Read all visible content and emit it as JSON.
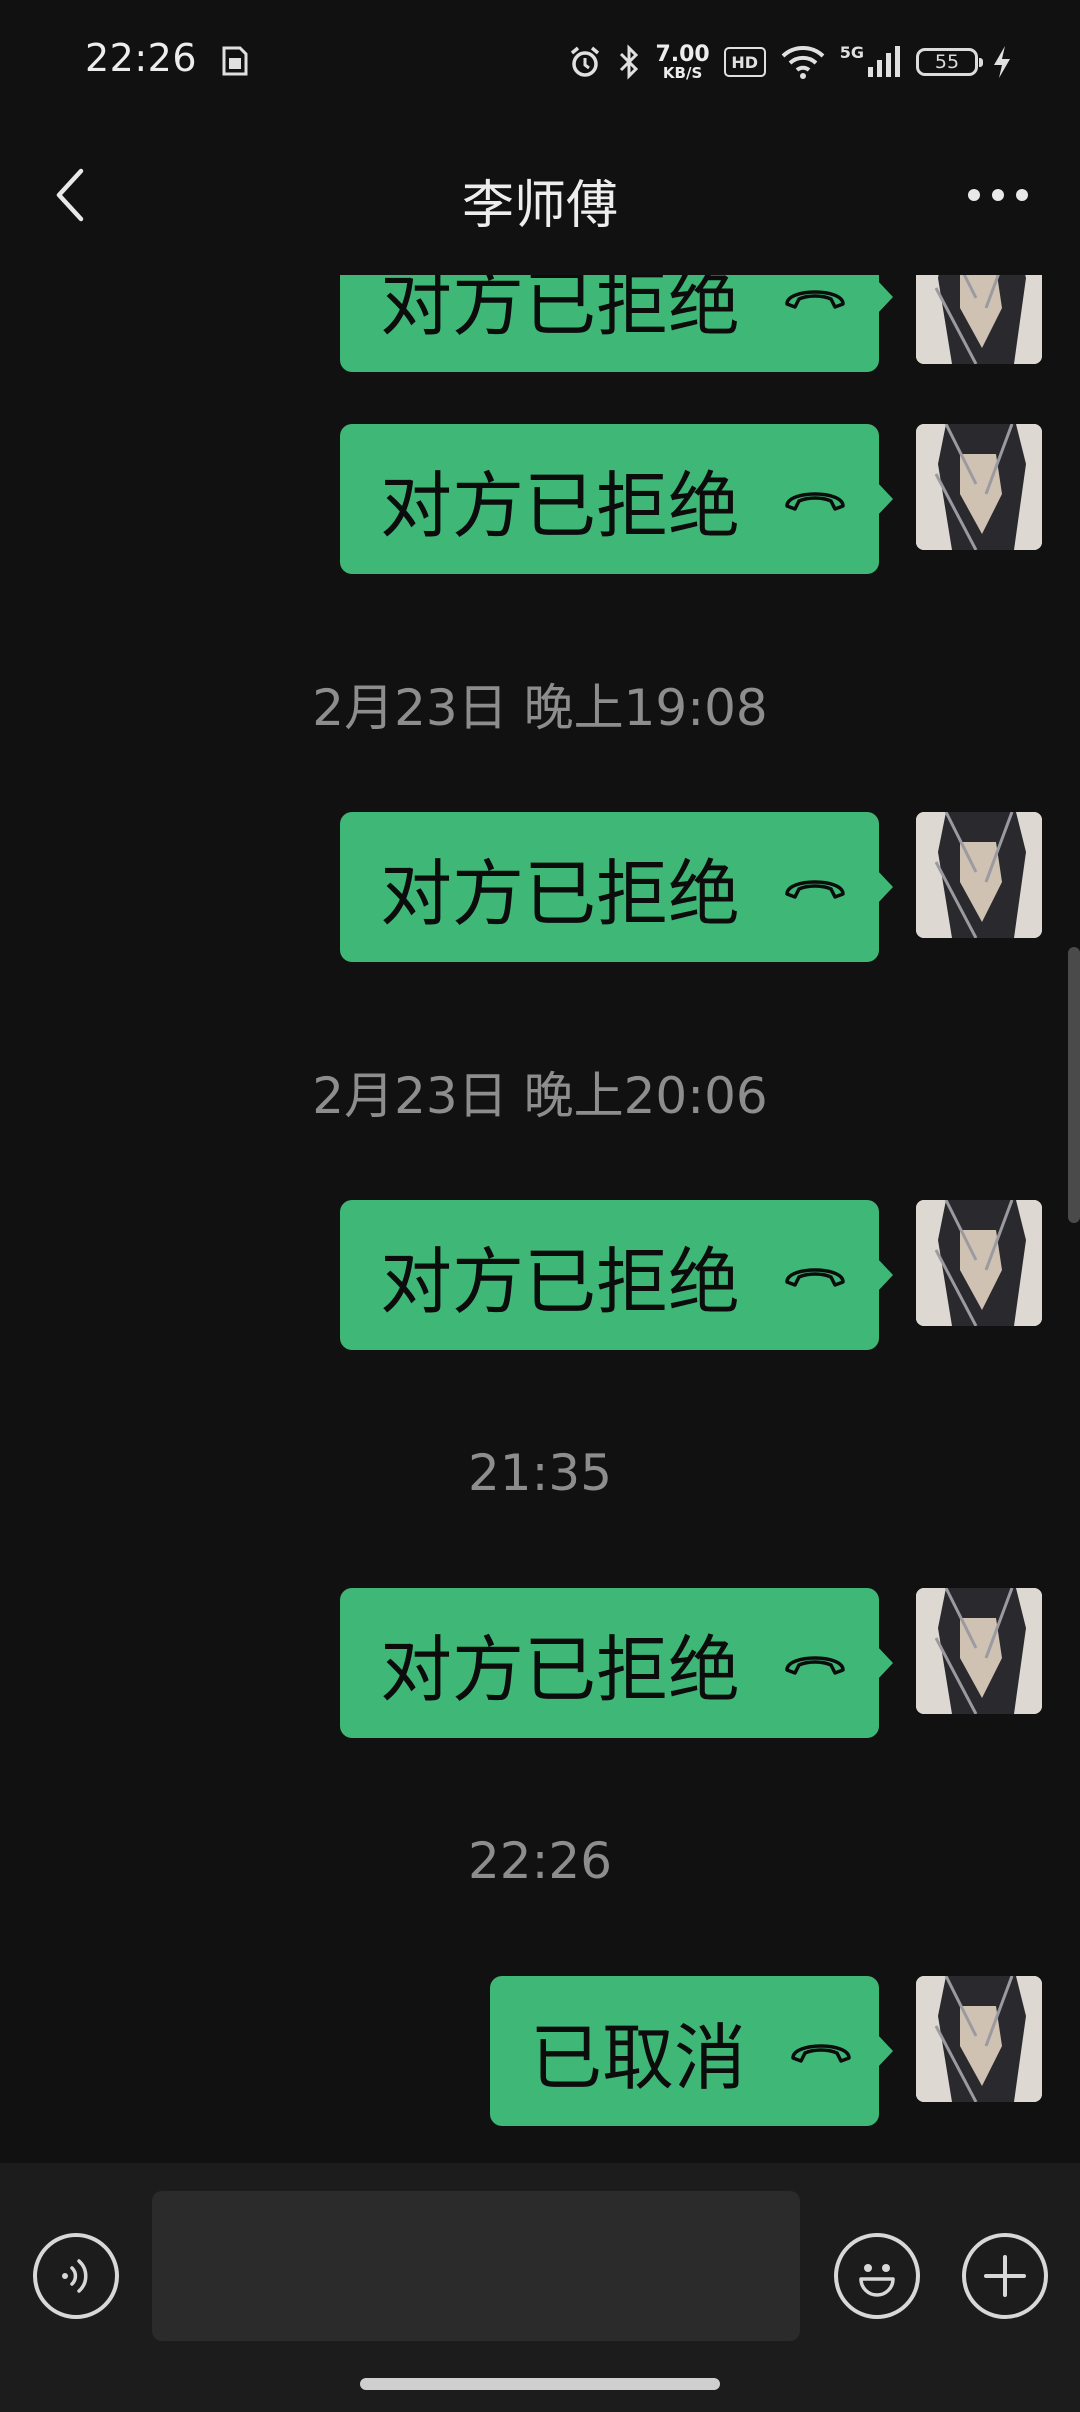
{
  "status_bar": {
    "time": "22:26",
    "net_speed_value": "7.00",
    "net_speed_unit": "KB/S",
    "hd_label": "HD",
    "network_label": "5G",
    "battery_level": "55",
    "icons": [
      "sim-card-icon",
      "alarm-icon",
      "bluetooth-icon",
      "wifi-icon",
      "signal-icon",
      "battery-icon",
      "charging-icon"
    ]
  },
  "header": {
    "title": "李师傅",
    "back_icon": "chevron-left-icon",
    "more_icon": "more-dots-icon"
  },
  "messages": [
    {
      "type": "call",
      "text": "对方已拒绝"
    },
    {
      "type": "call",
      "text": "对方已拒绝"
    },
    {
      "type": "timestamp",
      "text": "2月23日 晚上19:08"
    },
    {
      "type": "call",
      "text": "对方已拒绝"
    },
    {
      "type": "timestamp",
      "text": "2月23日 晚上20:06"
    },
    {
      "type": "call",
      "text": "对方已拒绝"
    },
    {
      "type": "timestamp",
      "text": "21:35"
    },
    {
      "type": "call",
      "text": "对方已拒绝"
    },
    {
      "type": "timestamp",
      "text": "22:26"
    },
    {
      "type": "call",
      "text": "已取消"
    }
  ],
  "input_bar": {
    "voice_icon": "voice-input-icon",
    "emoji_icon": "emoji-icon",
    "plus_icon": "plus-icon",
    "input_value": ""
  },
  "colors": {
    "background": "#111111",
    "bubble": "#3fb877",
    "timestamp": "#8d8d8d",
    "input_bar": "#1c1c1c"
  }
}
